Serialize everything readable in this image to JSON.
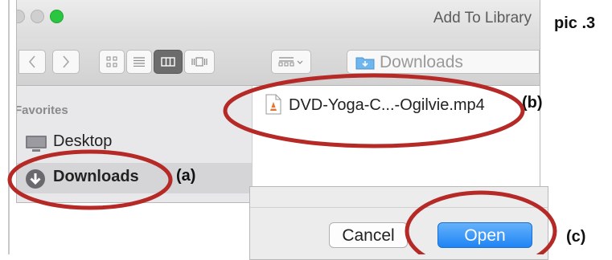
{
  "window": {
    "title": "Add To Library"
  },
  "toolbar": {
    "back_icon": "chevron-left-icon",
    "forward_icon": "chevron-right-icon",
    "view_modes": [
      "icons",
      "list",
      "columns",
      "cover-flow"
    ],
    "selected_view": "columns",
    "arrange_icon": "arrange-grid-icon",
    "location": "Downloads"
  },
  "sidebar": {
    "heading": "Favorites",
    "items": [
      {
        "label": "Desktop",
        "icon": "desktop-icon",
        "selected": false
      },
      {
        "label": "Downloads",
        "icon": "downloads-icon",
        "selected": true
      }
    ]
  },
  "files": [
    {
      "name": "DVD-Yoga-C...-Ogilvie.mp4",
      "icon": "video-file-icon"
    }
  ],
  "buttons": {
    "cancel": "Cancel",
    "open": "Open"
  },
  "annotations": {
    "caption": "pic .3",
    "label_a": "(a)",
    "label_b": "(b)",
    "label_c": "(c)",
    "ellipse_color": "#b52a26"
  },
  "colors": {
    "accent_blue": "#1f84f4",
    "zoom_green": "#2ac541"
  }
}
